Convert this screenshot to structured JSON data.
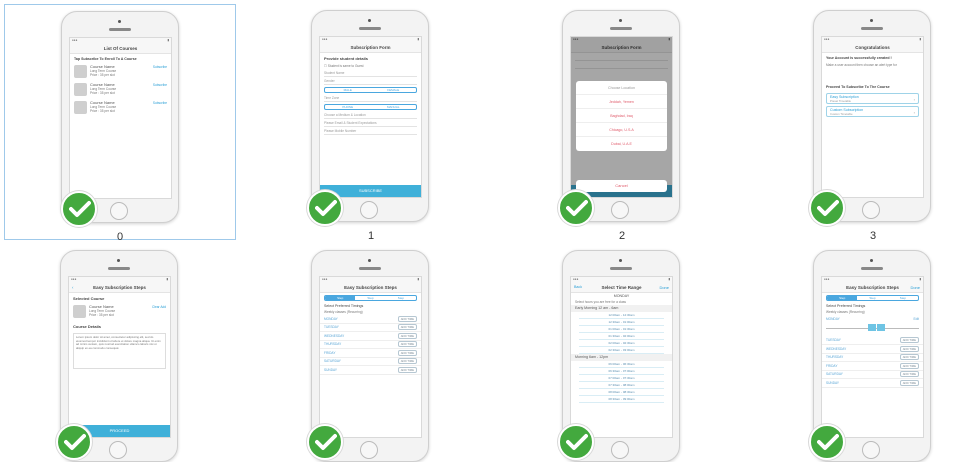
{
  "thumbnails": [
    {
      "label": "0",
      "title": "List Of Courses",
      "intro": "Tap Subscribe To Enroll To A Course",
      "courses": [
        {
          "name": "Course Name",
          "detail": "Long Term Course",
          "price": "Price : 35 per slot",
          "link": "Subscribe"
        },
        {
          "name": "Course Name",
          "detail": "Long Term Course",
          "price": "Price : 35 per slot",
          "link": "Subscribe"
        },
        {
          "name": "Course Name",
          "detail": "Long Term Course",
          "price": "Price : 35 per slot",
          "link": "Subscribe"
        }
      ]
    },
    {
      "label": "1",
      "title": "Subscription Form",
      "section": "Provide student details",
      "checkbox": "Student is same to Guest",
      "fields": [
        "Student Name",
        "Gender",
        "Time Zone",
        "Choose a Medium & Location",
        "Please Email & Student Expectations",
        "Please Mobile Number"
      ],
      "gender_options": [
        "MALE",
        "FEMALE"
      ],
      "tz_options": [
        "PHONE",
        "MANUAL"
      ],
      "button": "SUBSCRIBE"
    },
    {
      "label": "2",
      "title": "Subscription Form",
      "sheet_title": "Choose Location",
      "options": [
        "Jeddah, Yemen",
        "Baghdad, Iraq",
        "Chicago, U.S.A",
        "Dubai, U.A.E"
      ],
      "cancel": "Cancel",
      "button": "SUBSCRIBE"
    },
    {
      "label": "3",
      "title": "Congratulations",
      "headline": "Your Account is successfully created !",
      "body": "Make a user account then choose an alert type for",
      "proceed": "Proceed To Subscribe To The Course",
      "options": [
        {
          "title": "Easy Subscription",
          "sub": "Preset Timetable"
        },
        {
          "title": "Custom Subscription",
          "sub": "Custom Timetable"
        }
      ]
    },
    {
      "label": "",
      "title": "Easy Subscription Steps",
      "selected_heading": "Selected Course",
      "course": {
        "name": "Course Name",
        "detail": "Long Term Course",
        "price": "Price : 35 per slot",
        "link": "Clear Add"
      },
      "details_heading": "Course Details",
      "details": "Lorem ipsum dolor sit amet, consectetur adipiscing elit, sed do eiusmod tempor incididunt ut labore et dolore magna aliqua. Ut enim ad minim veniam, quis nostrud exercitation ullamco laboris nisi ut aliquip ex ea commodo consequat.",
      "button": "PROCEED"
    },
    {
      "label": "",
      "title": "Easy Subscription Steps",
      "tabs": [
        "Step",
        "Step",
        "Step"
      ],
      "prompt": "Select Preferred Timings",
      "hint": "Weekly classes (Recurring)",
      "days": [
        "MONDAY",
        "TUESDAY",
        "WEDNESDAY",
        "THURSDAY",
        "FRIDAY",
        "SATURDAY",
        "SUNDAY"
      ],
      "add_label": "ADD TIME"
    },
    {
      "label": "",
      "title": "Select Time Range",
      "left": "Back",
      "right": "Done",
      "day": "MONDAY",
      "hint": "Select hours you are free for a class",
      "range1": "Early Morning 12 am - 6am",
      "slots1": [
        "12:00am - 12:30am",
        "12:30am - 01:00am",
        "01:00am - 01:30am",
        "01:30am - 02:00am",
        "02:00am - 02:30am",
        "02:30am - 03:00am"
      ],
      "range2": "Morning 6am - 12pm",
      "slots2": [
        "06:00am - 06:30am",
        "06:30am - 07:00am",
        "07:00am - 07:30am",
        "07:30am - 08:00am",
        "08:00am - 08:30am",
        "08:30am - 09:00am"
      ]
    },
    {
      "label": "",
      "title": "Easy Subscription Steps",
      "right": "Done",
      "tabs": [
        "Step",
        "Step",
        "Step"
      ],
      "prompt": "Select Preferred Timings",
      "hint": "Weekly classes (Recurring)",
      "monday": "MONDAY",
      "edit": "Edit",
      "days": [
        "TUESDAY",
        "WEDNESDAY",
        "THURSDAY",
        "FRIDAY",
        "SATURDAY",
        "SUNDAY"
      ],
      "add_label": "ADD TIME"
    }
  ]
}
